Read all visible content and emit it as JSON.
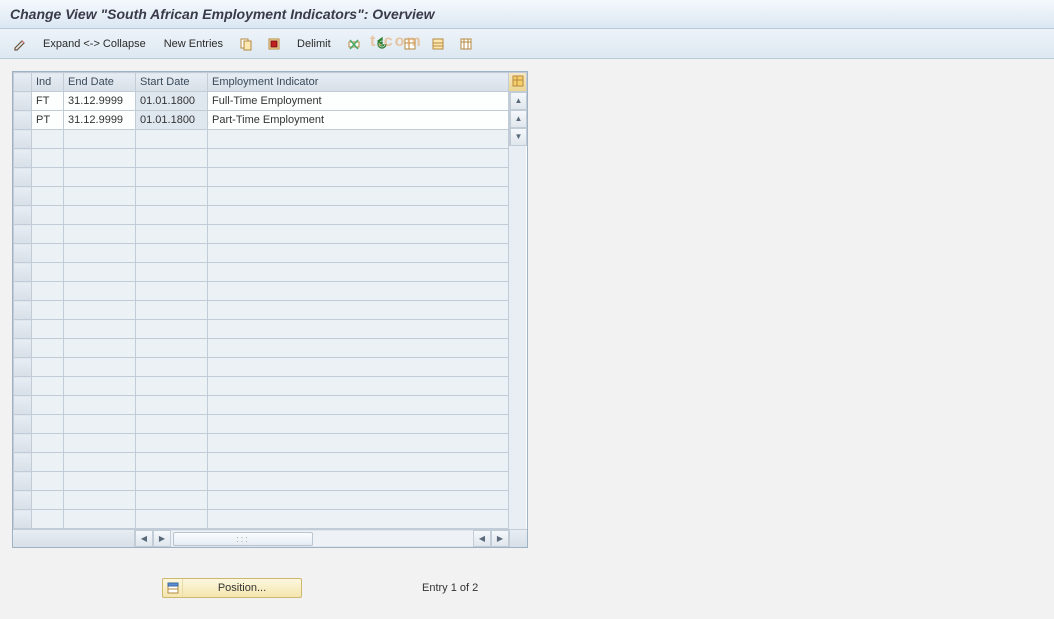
{
  "title": "Change View \"South African Employment Indicators\": Overview",
  "toolbar": {
    "expand_collapse": "Expand <-> Collapse",
    "new_entries": "New Entries",
    "delimit": "Delimit"
  },
  "watermark": "t.com",
  "grid": {
    "columns": {
      "ind": "Ind",
      "end_date": "End Date",
      "start_date": "Start Date",
      "desc": "Employment Indicator"
    },
    "rows": [
      {
        "ind": "FT",
        "end_date": "31.12.9999",
        "start_date": "01.01.1800",
        "desc": "Full-Time Employment"
      },
      {
        "ind": "PT",
        "end_date": "31.12.9999",
        "start_date": "01.01.1800",
        "desc": "Part-Time Employment"
      }
    ],
    "empty_rows": 21
  },
  "footer": {
    "position_label": "Position...",
    "entry_info": "Entry 1 of 2"
  },
  "icons": {
    "pencil": "pencil-icon",
    "copy": "copy-icon",
    "select_all": "select-all-icon",
    "delete": "delete-row-icon",
    "undo": "undo-icon",
    "table": "table-icon",
    "table2": "table-print-icon",
    "table3": "table-export-icon",
    "config": "table-config-icon"
  },
  "colors": {
    "header_grad_top": "#e7edf3",
    "accent_gold": "#ecd58f"
  }
}
